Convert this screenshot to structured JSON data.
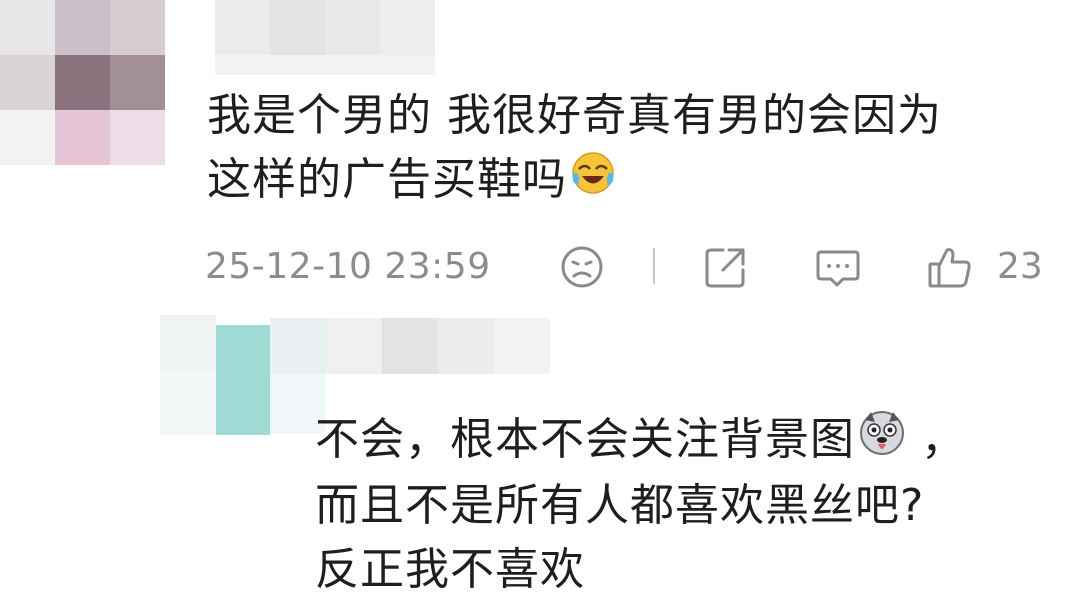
{
  "comment": {
    "line1": "我是个男的 我很好奇真有男的会因为",
    "line2": "这样的广告买鞋吗",
    "emoji": "laugh-cry-emoji",
    "timestamp": "25-12-10 23:59",
    "like_count": "23"
  },
  "reply": {
    "line1": "不会，根本不会关注背景图",
    "line1_suffix": "，",
    "line2": "而且不是所有人都喜欢黑丝吧?",
    "line3": "反正我不喜欢",
    "emoji": "husky-emoji"
  },
  "colors": {
    "text": "#1e1e1e",
    "meta": "#8c8c8c",
    "icon": "#8a8a8a"
  }
}
